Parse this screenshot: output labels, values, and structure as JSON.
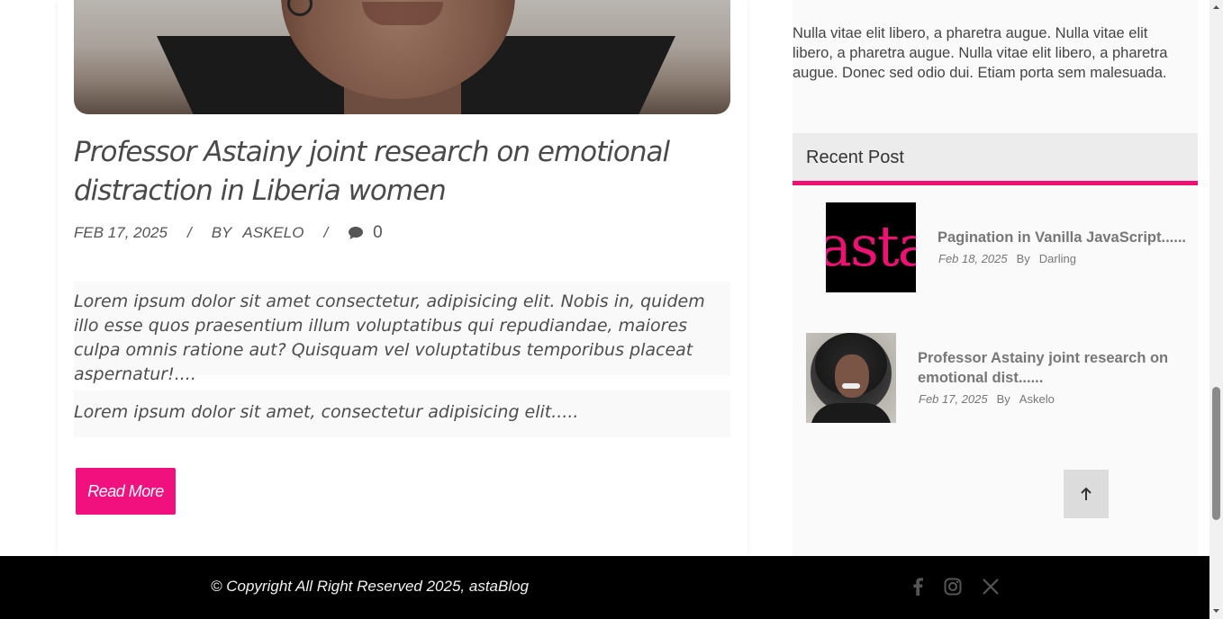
{
  "post": {
    "title": "Professor Astainy joint research on emotional distraction in Liberia women",
    "date": "FEB 17, 2025",
    "separator": "/",
    "by_label": "BY",
    "author": "ASKELO",
    "comment_count": "0",
    "excerpt_1": "Lorem ipsum dolor sit amet consectetur, adipisicing elit. Nobis in, quidem illo esse quos praesentium illum voluptatibus qui repudiandae, maiores culpa omnis ratione aut? Quisquam vel voluptatibus temporibus placeat aspernatur!....",
    "excerpt_2": "Lorem ipsum dolor sit amet, consectetur adipisicing elit.....",
    "read_more_label": "Read More",
    "hero_image_icon": "portrait-photo"
  },
  "sidebar": {
    "about_text": "Nulla vitae elit libero, a pharetra augue. Nulla vitae elit libero, a pharetra augue. Nulla vitae elit libero, a pharetra augue. Donec sed odio dui. Etiam porta sem malesuada.",
    "recent_heading": "Recent Post",
    "recent_posts": [
      {
        "title": "Pagination in Vanilla JavaScript......",
        "date": "Feb 18, 2025",
        "by_label": "By",
        "author": "Darling",
        "thumb_text": "asta"
      },
      {
        "title": "Professor Astainy joint research on emotional dist......",
        "date": "Feb 17, 2025",
        "by_label": "By",
        "author": "Askelo",
        "thumb_icon": "portrait-photo"
      }
    ]
  },
  "footer": {
    "copyright": "© Copyright All Right Reserved 2025, astaBlog",
    "social": [
      "facebook-icon",
      "instagram-icon",
      "x-icon"
    ]
  },
  "colors": {
    "accent": "#ee1173",
    "footer_bg": "#000000",
    "sidebar_bg": "#fafafa"
  }
}
